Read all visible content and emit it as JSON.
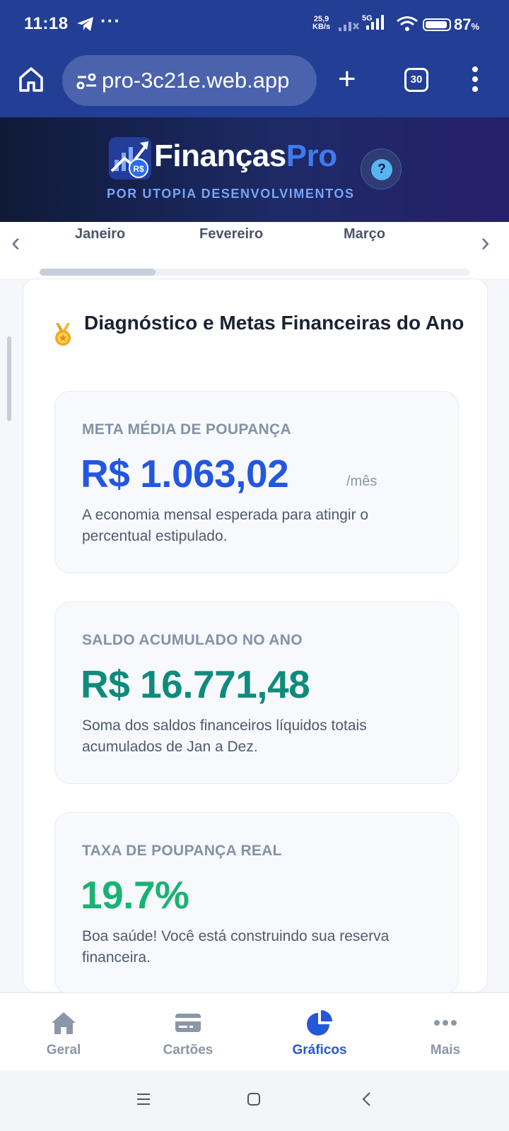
{
  "status_bar": {
    "time": "11:18",
    "speed_value": "25,9",
    "speed_unit": "KB/s",
    "network": "5G",
    "battery": "87",
    "battery_unit": "%"
  },
  "browser": {
    "url": "pro-3c21e.web.app",
    "tab_count": "30"
  },
  "app": {
    "name_part1": "Finanças",
    "name_part2": "Pro",
    "subtitle": "POR UTOPIA DESENVOLVIMENTOS",
    "help_label": "?"
  },
  "months": [
    "Janeiro",
    "Fevereiro",
    "Março"
  ],
  "month_scroll_fraction": 0.27,
  "section": {
    "title": "Diagnóstico e Metas Financeiras do Ano"
  },
  "cards": [
    {
      "label": "META MÉDIA DE POUPANÇA",
      "value": "R$ 1.063,02",
      "unit": "/mês",
      "description": "A economia mensal esperada para atingir o percentual estipulado.",
      "color": "#2357e0"
    },
    {
      "label": "SALDO ACUMULADO NO ANO",
      "value": "R$ 16.771,48",
      "description": "Soma dos saldos financeiros líquidos totais acumulados de Jan a Dez.",
      "color": "#0f8b7c"
    },
    {
      "label": "TAXA DE POUPANÇA REAL",
      "value": "19.7%",
      "description": "Boa saúde! Você está construindo sua reserva financeira.",
      "color": "#19b374"
    }
  ],
  "bottom_nav": [
    {
      "label": "Geral",
      "icon": "home-icon"
    },
    {
      "label": "Cartões",
      "icon": "credit-card-icon"
    },
    {
      "label": "Gráficos",
      "icon": "pie-chart-icon",
      "active": true
    },
    {
      "label": "Mais",
      "icon": "more-dots-icon"
    }
  ],
  "colors": {
    "browser_bar": "#223e95",
    "accent": "#2458d8",
    "inactive": "#8b96a6"
  }
}
